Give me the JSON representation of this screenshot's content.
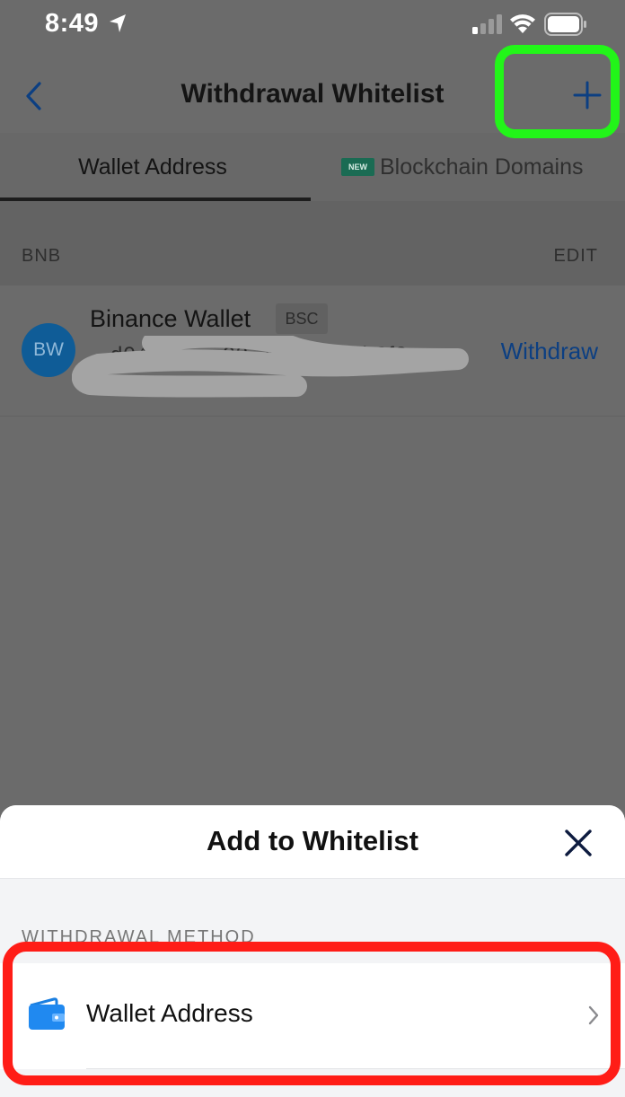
{
  "status_bar": {
    "time": "8:49",
    "icons": [
      "location-arrow-icon",
      "cellular-signal-icon",
      "wifi-icon",
      "battery-icon"
    ]
  },
  "nav": {
    "title": "Withdrawal Whitelist",
    "back_icon": "chevron-left-icon",
    "add_icon": "plus-icon"
  },
  "tabs": [
    {
      "label": "Wallet Address",
      "active": true
    },
    {
      "label": "Blockchain Domains",
      "badge": "NEW",
      "active": false
    }
  ],
  "section": {
    "title": "BNB",
    "edit_label": "EDIT"
  },
  "wallet": {
    "avatar_initials": "BW",
    "name": "Binance Wallet",
    "chain": "BSC",
    "address_partial": "...d04de... ...93..4... 59...4b3f2",
    "action_label": "Withdraw"
  },
  "sheet": {
    "title": "Add to Whitelist",
    "close_icon": "close-x-icon",
    "method_label": "WITHDRAWAL METHOD",
    "option_label": "Wallet Address",
    "option_icon": "wallet-icon"
  },
  "colors": {
    "accent_blue": "#1e88e5",
    "highlight_green": "#22f519",
    "highlight_red": "#ff1d17",
    "new_badge": "#1a6b53",
    "overlay_dim": "#6b6b6b"
  }
}
